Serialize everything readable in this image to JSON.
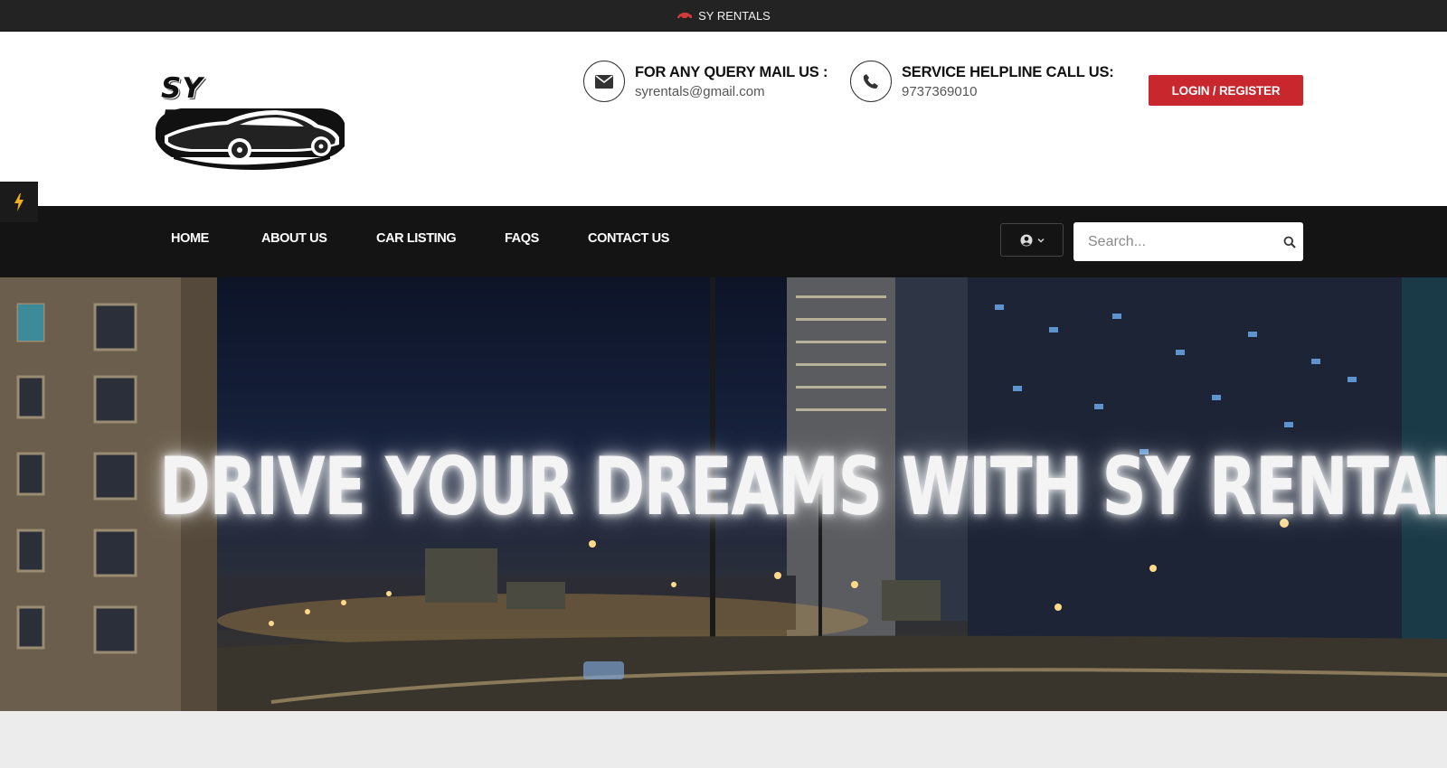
{
  "topbar": {
    "brand": "SY RENTALS",
    "icon": "car-icon"
  },
  "header": {
    "logo_text": "SY RENTALS",
    "mail": {
      "title": "FOR ANY QUERY MAIL US :",
      "value": "syrentals@gmail.com",
      "icon": "envelope-icon"
    },
    "phone": {
      "title": "SERVICE HELPLINE CALL US:",
      "value": "9737369010",
      "icon": "phone-icon"
    },
    "login_label": "LOGIN / REGISTER"
  },
  "nav": {
    "items": [
      {
        "label": "HOME"
      },
      {
        "label": "ABOUT US"
      },
      {
        "label": "CAR LISTING"
      },
      {
        "label": "FAQS"
      },
      {
        "label": "CONTACT US"
      }
    ],
    "user_menu_icon": "user-circle-icon",
    "search": {
      "placeholder": "Search...",
      "icon": "search-icon"
    }
  },
  "hero": {
    "title": "DRIVE YOUR DREAMS WITH SY RENTALS"
  },
  "colors": {
    "accent": "#c8272d",
    "nav_bg": "#141414",
    "topbar_bg": "#232323"
  }
}
